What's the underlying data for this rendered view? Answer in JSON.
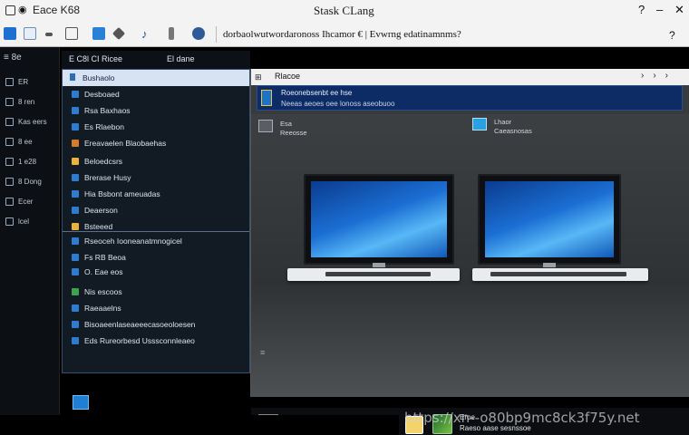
{
  "titlebar": {
    "app_title": "Eace K68",
    "window_title": "Stask CLang",
    "address": "dorbaolwutwordaronoss Ihcamor € | Evwrng edatinamnms?",
    "controls": [
      "?",
      "–",
      "✕"
    ],
    "find": "?"
  },
  "rail": {
    "top": "≡    8e",
    "items": [
      "ER",
      "8 ren",
      "Kas eers",
      "8 ee",
      "1 e28",
      "8 Dong",
      "Ecer",
      "lcel"
    ]
  },
  "nav": {
    "header_a": "E C8l CI Ricee",
    "header_b": "El dane",
    "items": [
      "Bushaolo",
      "Desboaed",
      "Rsa Baxhaos",
      "Es Rlaebon",
      "Ereavaelen Blaobaehas",
      "Beloedcsrs",
      "Brerase Husy",
      "Hia Bsbont ameuadas",
      "Deaerson",
      "Bsteeed",
      "Rseoceh Iooneanatmnogicel",
      "Fs RB Beoa",
      "O. Eae eos",
      "Nis escoos",
      "Raeaaelns",
      "Bisoaeenlaseaeeecasoeoloesen",
      "Eds Rureorbesd Usssconnleaeo"
    ]
  },
  "mainwin": {
    "title": "Rlacoe",
    "header_line1": "Roeonebsenbt ee hse",
    "header_line2": "Neeas aeoes oee lonoss aseobuoo",
    "file_a": [
      "Esa",
      "Reeosse"
    ],
    "file_b": [
      "Lhaor",
      "Caeasnosas"
    ],
    "taskbar_label": [
      "Eroe",
      "Raeso aase sesnssoe"
    ],
    "taskbar_selected": "30"
  },
  "colors": {
    "accent_blue": "#1e74c2",
    "header_navy": "#0d2c66",
    "nav_bg": "#121a24"
  },
  "watermark": "https://xn--o80bp9mc8ck3f75y.net"
}
